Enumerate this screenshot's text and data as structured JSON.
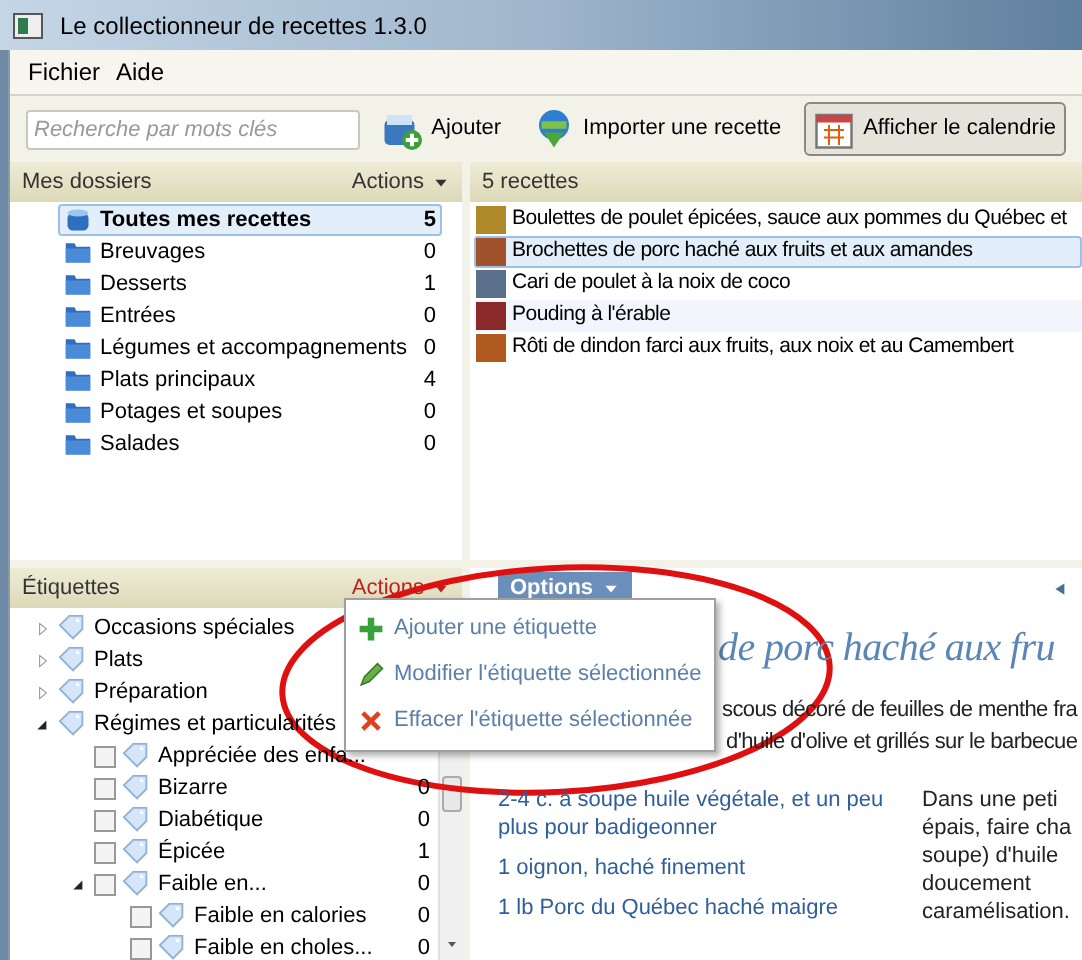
{
  "window": {
    "title": "Le collectionneur de recettes 1.3.0"
  },
  "menu": [
    "Fichier",
    "Aide"
  ],
  "search": {
    "placeholder": "Recherche par mots clés"
  },
  "toolbar": [
    {
      "label": "Ajouter",
      "kind": "add",
      "pressed": false
    },
    {
      "label": "Importer une recette",
      "kind": "import",
      "pressed": false
    },
    {
      "label": "Afficher le calendrie",
      "kind": "calendar",
      "pressed": true
    }
  ],
  "folders": {
    "title": "Mes dossiers",
    "actions": "Actions",
    "menu_open": false,
    "items": [
      {
        "name": "Toutes mes recettes",
        "count": "5",
        "kind": "all",
        "selected": true
      },
      {
        "name": "Breuvages",
        "count": "0",
        "kind": "folder",
        "selected": false
      },
      {
        "name": "Desserts",
        "count": "1",
        "kind": "folder",
        "selected": false
      },
      {
        "name": "Entrées",
        "count": "0",
        "kind": "folder",
        "selected": false
      },
      {
        "name": "Légumes et accompagnements",
        "count": "0",
        "kind": "folder",
        "selected": false
      },
      {
        "name": "Plats principaux",
        "count": "4",
        "kind": "folder",
        "selected": false
      },
      {
        "name": "Potages et soupes",
        "count": "0",
        "kind": "folder",
        "selected": false
      },
      {
        "name": "Salades",
        "count": "0",
        "kind": "folder",
        "selected": false
      }
    ]
  },
  "recipes": {
    "title": "5 recettes",
    "items": [
      {
        "name": "Boulettes de poulet épicées, sauce aux pommes du Québec et",
        "selected": false
      },
      {
        "name": "Brochettes de porc haché aux fruits et aux amandes",
        "selected": true
      },
      {
        "name": "Cari de poulet à la noix de coco",
        "selected": false
      },
      {
        "name": "Pouding à l'érable",
        "selected": false
      },
      {
        "name": "Rôti de dindon farci aux fruits, aux noix et au Camembert",
        "selected": false
      }
    ]
  },
  "tags": {
    "title": "Étiquettes",
    "actions": "Actions",
    "menu_open": true,
    "items": [
      {
        "name": "Occasions spéciales",
        "expanded": false
      },
      {
        "name": "Plats",
        "expanded": false
      },
      {
        "name": "Préparation",
        "expanded": false
      },
      {
        "name": "Régimes et particularités",
        "expanded": true,
        "children": [
          {
            "name": "Appréciée des enfa...",
            "checked": false
          },
          {
            "name": "Bizarre",
            "checked": false,
            "count": "0"
          },
          {
            "name": "Diabétique",
            "checked": false,
            "count": "0"
          },
          {
            "name": "Épicée",
            "checked": false,
            "count": "1"
          },
          {
            "name": "Faible en...",
            "checked": false,
            "count": "0",
            "expanded": true,
            "children": [
              {
                "name": "Faible en calories",
                "checked": false,
                "count": "0"
              },
              {
                "name": "Faible en choles...",
                "checked": false,
                "count": "0"
              }
            ]
          }
        ]
      }
    ],
    "menu": [
      {
        "label": "Ajouter une étiquette",
        "kind": "add"
      },
      {
        "label": "Modifier l'étiquette sélectionnée",
        "kind": "edit"
      },
      {
        "label": "Effacer l'étiquette sélectionnée",
        "kind": "delete"
      }
    ]
  },
  "detail": {
    "options": "Options",
    "title": "de porc haché aux fru",
    "description": [
      "scous décoré de feuilles de menthe fra",
      "d'huile d'olive et grillés sur le barbecue"
    ],
    "ingredients": [
      "2-4 c. à soupe huile végétale, et un peu plus pour badigeonner",
      "1 oignon, haché finement",
      "1 lb Porc du Québec haché maigre"
    ],
    "directions": [
      "Dans une peti",
      "épais, faire cha",
      "soupe) d'huile",
      "doucement",
      "caramélisation."
    ]
  }
}
